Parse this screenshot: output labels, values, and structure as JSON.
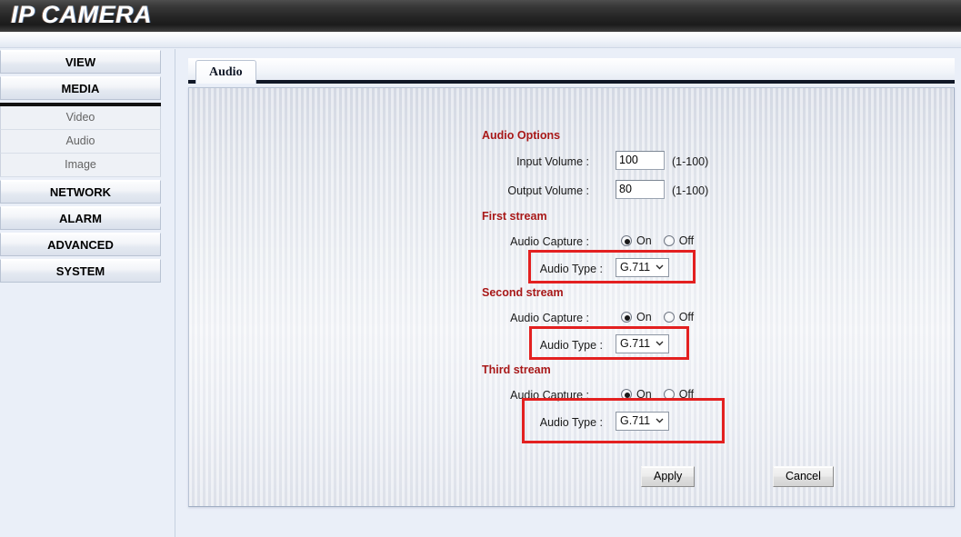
{
  "header": {
    "title": "IP CAMERA"
  },
  "sidebar": {
    "items": [
      {
        "label": "VIEW",
        "type": "main"
      },
      {
        "label": "MEDIA",
        "type": "main"
      },
      {
        "label": "Video",
        "type": "sub"
      },
      {
        "label": "Audio",
        "type": "sub"
      },
      {
        "label": "Image",
        "type": "sub"
      },
      {
        "label": "NETWORK",
        "type": "main"
      },
      {
        "label": "ALARM",
        "type": "main"
      },
      {
        "label": "ADVANCED",
        "type": "main"
      },
      {
        "label": "SYSTEM",
        "type": "main"
      }
    ]
  },
  "tabs": [
    {
      "label": "Audio",
      "active": true
    }
  ],
  "form": {
    "audio_options": {
      "section_title": "Audio Options",
      "input_volume_label": "Input Volume :",
      "input_volume_value": "100",
      "input_volume_hint": "(1-100)",
      "output_volume_label": "Output Volume :",
      "output_volume_value": "80",
      "output_volume_hint": "(1-100)"
    },
    "first_stream": {
      "section_title": "First stream",
      "audio_capture_label": "Audio Capture :",
      "radio_on_label": "On",
      "radio_off_label": "Off",
      "audio_capture_value": "On",
      "audio_type_label": "Audio Type :",
      "audio_type_value": "G.711"
    },
    "second_stream": {
      "section_title": "Second stream",
      "audio_capture_label": "Audio Capture :",
      "radio_on_label": "On",
      "radio_off_label": "Off",
      "audio_capture_value": "On",
      "audio_type_label": "Audio Type :",
      "audio_type_value": "G.711"
    },
    "third_stream": {
      "section_title": "Third stream",
      "audio_capture_label": "Audio Capture :",
      "radio_on_label": "On",
      "radio_off_label": "Off",
      "audio_capture_value": "On",
      "audio_type_label": "Audio Type :",
      "audio_type_value": "G.711"
    },
    "buttons": {
      "apply_label": "Apply",
      "cancel_label": "Cancel"
    }
  },
  "annotations": {
    "highlight_color": "#e32020",
    "boxes": [
      {
        "target": "first-stream-audio-type"
      },
      {
        "target": "second-stream-audio-type"
      },
      {
        "target": "third-stream-audio-type"
      }
    ]
  },
  "colors": {
    "section_red": "#a81818",
    "header_bg": "#262626",
    "page_bg": "#eaeff8"
  }
}
